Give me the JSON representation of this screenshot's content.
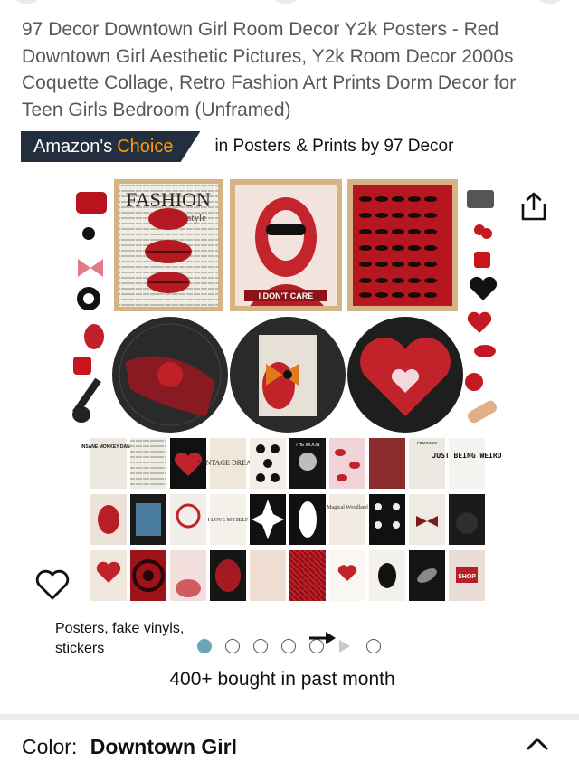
{
  "product": {
    "title": "97 Decor Downtown Girl Room Decor Y2k Posters - Red Downtown Girl Aesthetic Pictures, Y2k Room Decor 2000s Coquette Collage, Retro Fashion Art Prints Dorm Decor for Teen Girls Bedroom (Unframed)",
    "badge_prefix": "Amazon's",
    "badge_choice": "Choice",
    "badge_category": "in Posters & Prints by 97 Decor",
    "image_caption": "Posters, fake vinyls, stickers",
    "bought_text": "400+ bought in past month"
  },
  "image_text": {
    "fashion": "FASHION",
    "style": "style",
    "dont_care": "I DON'T CARE",
    "insane": "INSANE MONKEY DANCE",
    "vintage": "VINTAGE DREAM",
    "the_moon": "THE MOON",
    "feminism": "FEMINISM",
    "just_being_weird": "JUST BEING WEIRD",
    "magical": "Magical Woodland",
    "love_myself": "I LOVE MYSELF",
    "shop": "SHOP"
  },
  "carousel": {
    "total": 7,
    "active_index": 0,
    "video_index": 5
  },
  "variation": {
    "label": "Color:",
    "value": "Downtown Girl"
  },
  "icons": {
    "share": "share-icon",
    "wishlist": "heart-outline-icon",
    "expand": "chevron-up-icon",
    "swipe": "arrow-right-icon"
  },
  "colors": {
    "badge_bg": "#232f3e",
    "badge_accent": "#ff9900",
    "dot_active": "#6aa5b8",
    "poster_red": "#b01c22"
  }
}
